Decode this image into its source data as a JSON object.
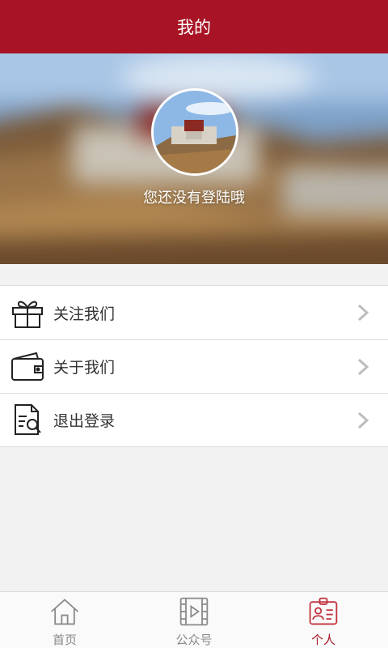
{
  "header": {
    "title": "我的"
  },
  "profile": {
    "status_text": "您还没有登陆哦"
  },
  "menu": {
    "items": [
      {
        "label": "关注我们",
        "icon": "gift-icon"
      },
      {
        "label": "关于我们",
        "icon": "wallet-icon"
      },
      {
        "label": "退出登录",
        "icon": "document-search-icon"
      }
    ]
  },
  "tabbar": {
    "tabs": [
      {
        "label": "首页",
        "icon": "home-icon",
        "active": false
      },
      {
        "label": "公众号",
        "icon": "video-icon",
        "active": false
      },
      {
        "label": "个人",
        "icon": "id-card-icon",
        "active": true
      }
    ]
  },
  "colors": {
    "accent": "#a81425",
    "tab_inactive": "#888888",
    "background": "#f2f2f2"
  }
}
